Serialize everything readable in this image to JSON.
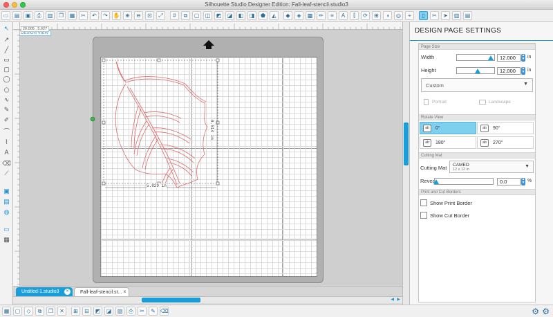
{
  "window": {
    "title": "Silhouette Studio Designer Edition: Fall-leaf-stencil.studio3"
  },
  "colors": {
    "accent": "#1a9ed9",
    "shape_line": "#e06a6a",
    "selected_rotate": "#7fd0ef"
  },
  "toolbar": {
    "icons": [
      "new-icon",
      "open-icon",
      "save-icon",
      "print-icon",
      "cut-icon",
      "copy-icon",
      "paste-icon",
      "undo-icon",
      "redo-icon",
      "select-icon",
      "zoom-in-icon",
      "zoom-out-icon",
      "zoom-fit-icon",
      "zoom-custom-icon",
      "grid-icon",
      "page-icon",
      "draw-icon",
      "shape-icon",
      "rotate-icon",
      "align-icon",
      "group-icon",
      "ungroup-icon",
      "fill-icon",
      "line-icon",
      "text-icon",
      "offset-icon",
      "trace-icon",
      "cut-settings-icon",
      "send-icon"
    ]
  },
  "canvas": {
    "design_view_label": "DESIGN VIEW",
    "coordinates": "20.005 , 5.627",
    "width_label": "5.829 in",
    "height_label": "8.514 in"
  },
  "tabs": [
    {
      "label": "Untitled-1.studio3",
      "close": "✕",
      "active": false
    },
    {
      "label": "Fall-leaf-stencil.st...",
      "close": "x",
      "active": true
    }
  ],
  "panel": {
    "title": "DESIGN PAGE SETTINGS",
    "page_size": {
      "section": "Page Size",
      "width_label": "Width",
      "width_value": "12.000",
      "height_label": "Height",
      "height_value": "12.000",
      "unit": "in",
      "preset": "Custom",
      "portrait_label": "Portrait",
      "landscape_label": "Landscape"
    },
    "rotate_view": {
      "section": "Rotate View",
      "options": [
        "0°",
        "90°",
        "180°",
        "270°"
      ],
      "selected": "0°"
    },
    "cutting_mat": {
      "section": "Cutting Mat",
      "label": "Cutting Mat",
      "value": "CAMEO",
      "sub_value": "12 x 12 in",
      "reveal_label": "Reveal",
      "reveal_value": "0.0",
      "reveal_unit": "%"
    },
    "borders": {
      "section": "Print and Cut Borders",
      "show_print_border": "Show Print Border",
      "show_cut_border": "Show Cut Border"
    }
  }
}
